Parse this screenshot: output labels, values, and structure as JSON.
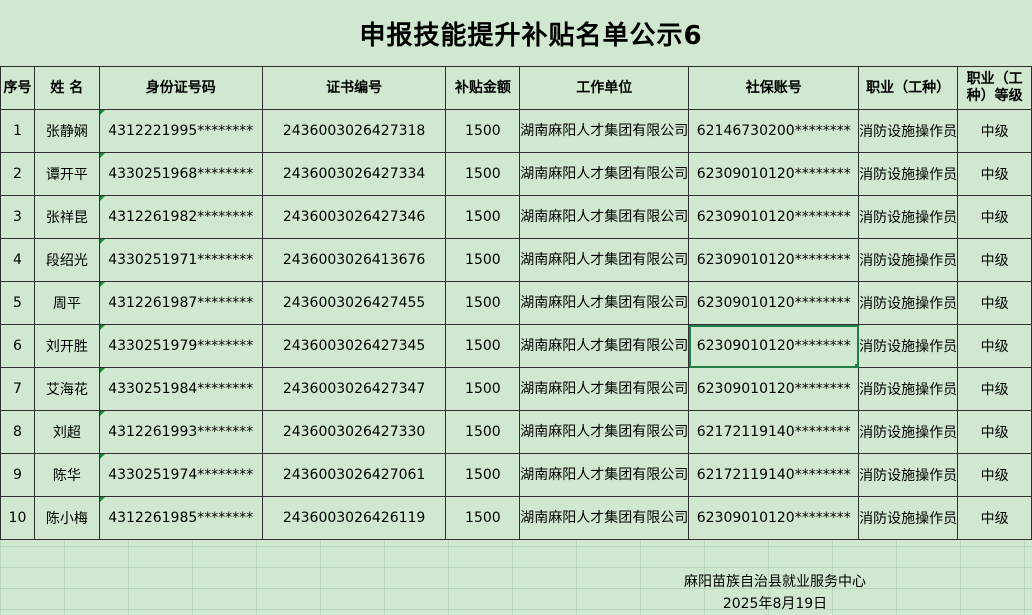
{
  "title": "申报技能提升补贴名单公示6",
  "headers": {
    "index": "序号",
    "name": "姓 名",
    "id_number": "身份证号码",
    "certificate": "证书编号",
    "subsidy": "补贴金额",
    "unit": "工作单位",
    "social_security": "社保账号",
    "occupation": "职业（工种）",
    "level": "职业（工种）等级"
  },
  "rows": [
    {
      "index": "1",
      "name": "张静娴",
      "id_number": "4312221995********",
      "certificate": "2436003026427318",
      "subsidy": "1500",
      "unit": "湖南麻阳人才集团有限公司",
      "social_security": "62146730200********",
      "occupation": "消防设施操作员",
      "level": "中级"
    },
    {
      "index": "2",
      "name": "谭开平",
      "id_number": "4330251968********",
      "certificate": "2436003026427334",
      "subsidy": "1500",
      "unit": "湖南麻阳人才集团有限公司",
      "social_security": "62309010120********",
      "occupation": "消防设施操作员",
      "level": "中级"
    },
    {
      "index": "3",
      "name": "张祥昆",
      "id_number": "4312261982********",
      "certificate": "2436003026427346",
      "subsidy": "1500",
      "unit": "湖南麻阳人才集团有限公司",
      "social_security": "62309010120********",
      "occupation": "消防设施操作员",
      "level": "中级"
    },
    {
      "index": "4",
      "name": "段绍光",
      "id_number": "4330251971********",
      "certificate": "2436003026413676",
      "subsidy": "1500",
      "unit": "湖南麻阳人才集团有限公司",
      "social_security": "62309010120********",
      "occupation": "消防设施操作员",
      "level": "中级"
    },
    {
      "index": "5",
      "name": "周平",
      "id_number": "4312261987********",
      "certificate": "2436003026427455",
      "subsidy": "1500",
      "unit": "湖南麻阳人才集团有限公司",
      "social_security": "62309010120********",
      "occupation": "消防设施操作员",
      "level": "中级"
    },
    {
      "index": "6",
      "name": "刘开胜",
      "id_number": "4330251979********",
      "certificate": "2436003026427345",
      "subsidy": "1500",
      "unit": "湖南麻阳人才集团有限公司",
      "social_security": "62309010120********",
      "occupation": "消防设施操作员",
      "level": "中级"
    },
    {
      "index": "7",
      "name": "艾海花",
      "id_number": "4330251984********",
      "certificate": "2436003026427347",
      "subsidy": "1500",
      "unit": "湖南麻阳人才集团有限公司",
      "social_security": "62309010120********",
      "occupation": "消防设施操作员",
      "level": "中级"
    },
    {
      "index": "8",
      "name": "刘超",
      "id_number": "4312261993********",
      "certificate": "2436003026427330",
      "subsidy": "1500",
      "unit": "湖南麻阳人才集团有限公司",
      "social_security": "62172119140********",
      "occupation": "消防设施操作员",
      "level": "中级"
    },
    {
      "index": "9",
      "name": "陈华",
      "id_number": "4330251974********",
      "certificate": "2436003026427061",
      "subsidy": "1500",
      "unit": "湖南麻阳人才集团有限公司",
      "social_security": "62172119140********",
      "occupation": "消防设施操作员",
      "level": "中级"
    },
    {
      "index": "10",
      "name": "陈小梅",
      "id_number": "4312261985********",
      "certificate": "2436003026426119",
      "subsidy": "1500",
      "unit": "湖南麻阳人才集团有限公司",
      "social_security": "62309010120********",
      "occupation": "消防设施操作员",
      "level": "中级"
    }
  ],
  "footer": {
    "organization": "麻阳苗族自治县就业服务中心",
    "date": "2025年8月19日"
  },
  "colors": {
    "sheet_background": "#cfe8cf",
    "selection_border": "#1e7e45"
  }
}
